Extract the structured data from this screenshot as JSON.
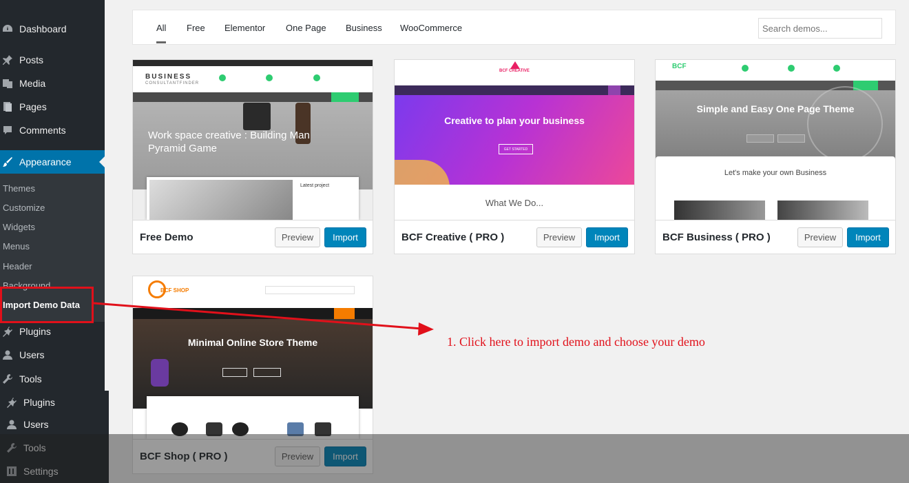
{
  "sidebar": {
    "items": [
      {
        "label": "Dashboard",
        "icon": "dashboard-icon"
      },
      {
        "label": "Posts",
        "icon": "pin-icon"
      },
      {
        "label": "Media",
        "icon": "media-icon"
      },
      {
        "label": "Pages",
        "icon": "pages-icon"
      },
      {
        "label": "Comments",
        "icon": "comments-icon"
      },
      {
        "label": "Appearance",
        "icon": "brush-icon"
      },
      {
        "label": "Plugins",
        "icon": "plugin-icon"
      },
      {
        "label": "Users",
        "icon": "user-icon"
      },
      {
        "label": "Tools",
        "icon": "wrench-icon"
      }
    ],
    "submenu": [
      "Themes",
      "Customize",
      "Widgets",
      "Menus",
      "Header",
      "Background",
      "Import Demo Data"
    ],
    "bottom_items": [
      {
        "label": "Plugins",
        "icon": "plugin-icon"
      },
      {
        "label": "Users",
        "icon": "user-icon"
      },
      {
        "label": "Tools",
        "icon": "wrench-icon"
      },
      {
        "label": "Settings",
        "icon": "settings-icon"
      }
    ]
  },
  "tabs": [
    "All",
    "Free",
    "Elementor",
    "One Page",
    "Business",
    "WooCommerce"
  ],
  "search": {
    "placeholder": "Search demos..."
  },
  "buttons": {
    "preview": "Preview",
    "import": "Import"
  },
  "demos": [
    {
      "name": "Free Demo",
      "logo": "BUSINESS",
      "logo_sub": "CONSULTANTFINDER",
      "hero": "Work space creative : Building Man Pyramid Game",
      "card_title": "Latest project",
      "colors": {
        "accent": "#2ecc71",
        "hero": "#a9a9a9"
      }
    },
    {
      "name": "BCF Creative ( PRO )",
      "logo": "BCF CREATIVE",
      "hero": "Creative to plan your business",
      "cta": "GET STARTED",
      "section": "What We Do...",
      "colors": {
        "accent": "#e91e63",
        "hero_from": "#7c3aed",
        "hero_to": "#ec4899"
      }
    },
    {
      "name": "BCF Business ( PRO )",
      "logo": "BCF",
      "hero": "Simple and Easy One Page Theme",
      "section": "Let's make your own Business",
      "colors": {
        "accent": "#2ecc71",
        "hero": "#8a8a8a"
      }
    },
    {
      "name": "BCF Shop ( PRO )",
      "logo": "BCF SHOP",
      "hero": "Minimal Online Store Theme",
      "colors": {
        "accent": "#f57c00",
        "hero": "#3a3a3a"
      }
    }
  ],
  "annotation": "1. Click here to import demo and choose your demo",
  "colors": {
    "admin_bg": "#23282d",
    "active": "#0073aa",
    "import_btn": "#0085ba",
    "annotation": "#e1101a"
  }
}
